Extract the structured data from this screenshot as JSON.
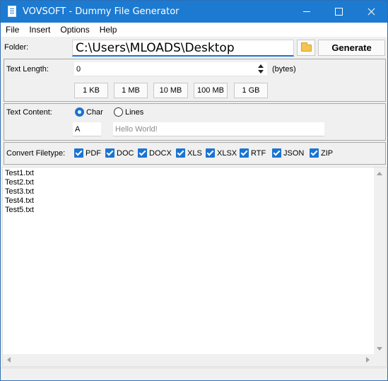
{
  "window": {
    "title": "VOVSOFT - Dummy File Generator",
    "accent_color": "#1c7ad1",
    "icons": {
      "app": "document-icon",
      "minimize": "minimize-icon",
      "maximize": "maximize-icon",
      "close": "close-icon"
    }
  },
  "menu": {
    "items": [
      "File",
      "Insert",
      "Options",
      "Help"
    ]
  },
  "folder": {
    "label": "Folder:",
    "value": "C:\\Users\\MLOADS\\Desktop",
    "browse_icon": "folder-open-icon",
    "generate_label": "Generate"
  },
  "text_length": {
    "label": "Text Length:",
    "value": "0",
    "unit": "(bytes)",
    "presets": [
      "1 KB",
      "1 MB",
      "10 MB",
      "100 MB",
      "1 GB"
    ]
  },
  "text_content": {
    "label": "Text Content:",
    "options": [
      "Char",
      "Lines"
    ],
    "selected": "Char",
    "char_value": "A",
    "text_placeholder": "Hello World!"
  },
  "convert": {
    "label": "Convert Filetype:",
    "types": [
      "PDF",
      "DOC",
      "DOCX",
      "XLS",
      "XLSX",
      "RTF",
      "JSON",
      "ZIP"
    ],
    "all_checked": true
  },
  "output": {
    "lines": [
      "Test1.txt",
      "Test2.txt",
      "Test3.txt",
      "Test4.txt",
      "Test5.txt"
    ]
  }
}
